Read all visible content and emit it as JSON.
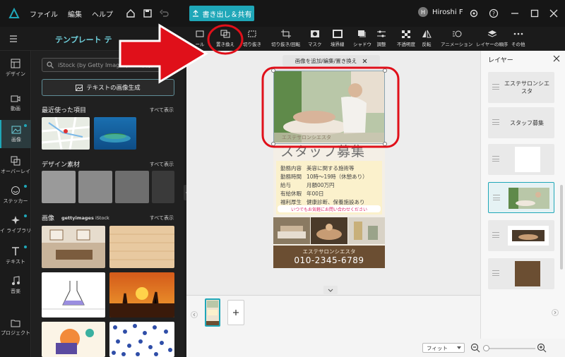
{
  "menubar": {
    "menus": [
      "ファイル",
      "編集",
      "ヘルプ"
    ],
    "export_label": "書き出し＆共有",
    "user_initial": "H",
    "user_name": "Hiroshi F"
  },
  "subbar": {
    "template_title": "テンプレート テ",
    "tools": [
      {
        "label": "ール",
        "icon": "tool-icon"
      },
      {
        "label": "置き換え",
        "icon": "replace-icon"
      },
      {
        "label": "切り抜き",
        "icon": "cutout-icon"
      },
      {
        "label": "切り抜き/回転",
        "icon": "crop-icon"
      },
      {
        "label": "マスク",
        "icon": "mask-icon"
      },
      {
        "label": "境界線",
        "icon": "border-icon"
      },
      {
        "label": "シャドウ",
        "icon": "shadow-icon"
      },
      {
        "label": "調整",
        "icon": "adjust-icon"
      },
      {
        "label": "不透明度",
        "icon": "opacity-icon"
      },
      {
        "label": "反転",
        "icon": "flip-icon"
      },
      {
        "label": "アニメーション",
        "icon": "animation-icon"
      },
      {
        "label": "レイヤーの順序",
        "icon": "layer-order-icon"
      },
      {
        "label": "その他",
        "icon": "more-icon"
      }
    ]
  },
  "rail": {
    "items": [
      {
        "label": "デザイン",
        "icon": "design-icon"
      },
      {
        "label": "動画",
        "icon": "video-icon"
      },
      {
        "label": "画像",
        "icon": "image-icon"
      },
      {
        "label": "オーバーレイ",
        "icon": "overlay-icon"
      },
      {
        "label": "ステッカー",
        "icon": "sticker-icon"
      },
      {
        "label": "マイ ライブラリー",
        "icon": "library-icon"
      },
      {
        "label": "テキスト",
        "icon": "text-icon"
      },
      {
        "label": "音楽",
        "icon": "music-icon"
      },
      {
        "label": "プロジェクト",
        "icon": "project-icon"
      }
    ]
  },
  "panel": {
    "search_placeholder": "iStock (by Getty Images) から検索",
    "generate_label": "テキストの画像生成",
    "recent_title": "最近使った項目",
    "design_title": "デザイン素材",
    "images_title": "画像",
    "images_brand_a": "gettyimages",
    "images_brand_b": "iStock",
    "see_all": "すべて表示"
  },
  "canvas": {
    "tooltip": "画像を追加/編集/置き換え",
    "flyer": {
      "salon_small": "エステサロンシエスタ",
      "headline": "スタッフ募集",
      "rows": [
        {
          "k": "勤務内容",
          "v": "美容に関する施術等"
        },
        {
          "k": "勤務時間",
          "v": "10時～19時（休憩あり）"
        },
        {
          "k": "給与",
          "v": "月額00万円"
        },
        {
          "k": "有給休暇",
          "v": "年00日"
        },
        {
          "k": "福利厚生",
          "v": "健康診断、保養施設あり"
        }
      ],
      "cta": "いつでもお気軽にお問い合わせください",
      "footer_name": "エステサロンシエスタ",
      "footer_phone": "010-2345-6789"
    }
  },
  "layers": {
    "title": "レイヤー",
    "items": [
      "エステサロンシエスタ",
      "スタッフ募集"
    ]
  },
  "footer": {
    "zoom_select": "フィット"
  },
  "colors": {
    "accent": "#1fa7b8",
    "annotation_red": "#e0101a"
  }
}
